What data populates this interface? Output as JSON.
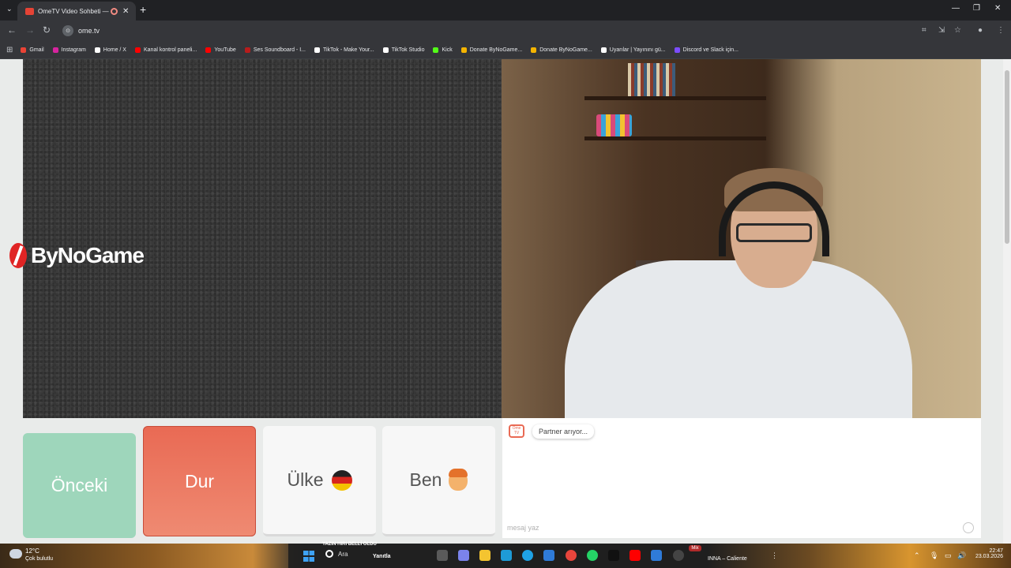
{
  "browser": {
    "tab": {
      "title": "OmeTV Video Sohbeti — O"
    },
    "address": {
      "url": "ome.tv"
    },
    "bookmarks": [
      {
        "label": "Gmail",
        "color": "#ea4335"
      },
      {
        "label": "Instagram",
        "color": "#d6249f"
      },
      {
        "label": "Home / X",
        "color": "#ffffff"
      },
      {
        "label": "Kanal kontrol paneli...",
        "color": "#ff0000"
      },
      {
        "label": "YouTube",
        "color": "#ff0000"
      },
      {
        "label": "Ses Soundboard - I...",
        "color": "#b71c1c"
      },
      {
        "label": "TikTok - Make Your...",
        "color": "#ffffff"
      },
      {
        "label": "TikTok Studio",
        "color": "#ffffff"
      },
      {
        "label": "Kick",
        "color": "#53fc18"
      },
      {
        "label": "Donate ByNoGame...",
        "color": "#f4b400"
      },
      {
        "label": "Donate ByNoGame...",
        "color": "#f4b400"
      },
      {
        "label": "Uyarılar | Yayınını gü...",
        "color": "#ffffff"
      },
      {
        "label": "Discord ve Slack için...",
        "color": "#7c4dff"
      }
    ]
  },
  "video": {
    "watermark": "ByNoGame"
  },
  "controls": {
    "previous": "Önceki",
    "stop": "Dur",
    "country": "Ülke",
    "me": "Ben"
  },
  "chat": {
    "logo": "Ome TV",
    "status": "Partner arıyor...",
    "input_placeholder": "mesaj yaz"
  },
  "taskbar": {
    "weather_temp": "12°C",
    "weather_desc": "Çok bulutlu",
    "news_headline": "YAZIN HIRI BELLİ OLDU",
    "search_label": "Ara",
    "reply_label": "Yanıtla",
    "media_title": "INNA – Caliente",
    "media_badge": "Mix",
    "time": "22:47",
    "date": "23.03.2026"
  },
  "colors": {
    "accent_stop": "#e96a54",
    "accent_prev": "#9ed6bb",
    "page_bg": "#e9ebea"
  }
}
